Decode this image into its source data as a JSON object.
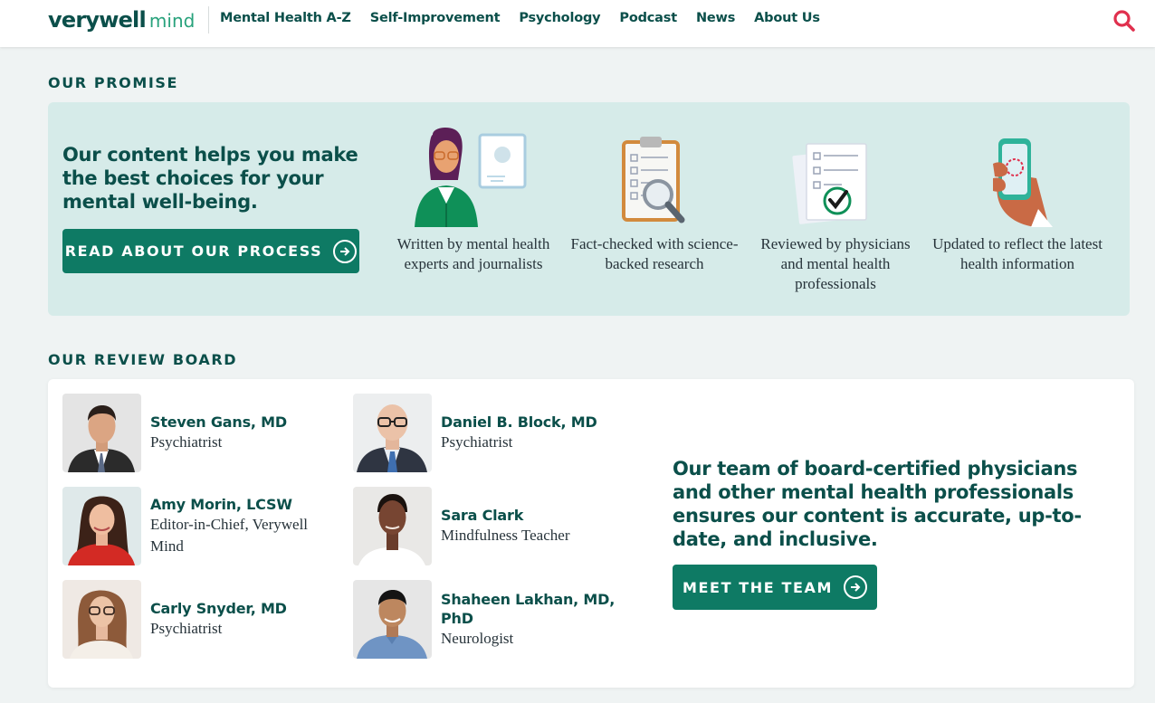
{
  "header": {
    "logo_main": "verywell",
    "logo_sub": "mind",
    "nav": [
      "Mental Health A-Z",
      "Self-Improvement",
      "Psychology",
      "Podcast",
      "News",
      "About Us"
    ],
    "search_icon": "search-icon"
  },
  "promise": {
    "heading": "OUR PROMISE",
    "text": "Our content helps you make the best choices for your mental well-being.",
    "button_label": "READ ABOUT OUR PROCESS",
    "features": [
      {
        "icon": "expert-illustration",
        "label": "Written by mental health experts and journalists"
      },
      {
        "icon": "clipboard-magnifier-illustration",
        "label": "Fact-checked with science-backed research"
      },
      {
        "icon": "reviewed-checklist-illustration",
        "label": "Reviewed by physicians and mental health professionals"
      },
      {
        "icon": "phone-refresh-illustration",
        "label": "Updated to reflect the latest health information"
      }
    ]
  },
  "board": {
    "heading": "OUR REVIEW BOARD",
    "members": [
      {
        "name": "Steven Gans, MD",
        "role": "Psychiatrist"
      },
      {
        "name": "Daniel B. Block, MD",
        "role": "Psychiatrist"
      },
      {
        "name": "Amy Morin, LCSW",
        "role": "Editor-in-Chief, Verywell Mind"
      },
      {
        "name": "Sara Clark",
        "role": "Mindfulness Teacher"
      },
      {
        "name": "Carly Snyder, MD",
        "role": "Psychiatrist"
      },
      {
        "name": "Shaheen Lakhan, MD, PhD",
        "role": "Neurologist"
      }
    ],
    "text": "Our team of board-certified physicians and other mental health professionals ensures our content is accurate, up-to-date, and inclusive.",
    "button_label": "MEET THE TEAM"
  },
  "colors": {
    "brand_dark": "#0b4f4a",
    "brand_green": "#0e7a64",
    "promise_bg": "#d6ebe9",
    "search_red": "#e0304e"
  }
}
